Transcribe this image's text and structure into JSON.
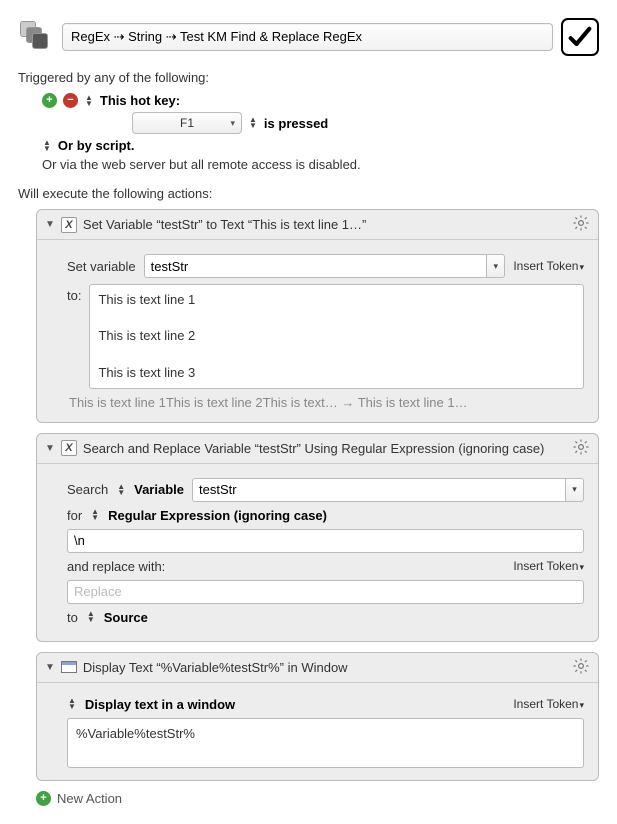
{
  "titlebar": {
    "macro_path": "RegEx ⇢ String ⇢ Test KM Find & Replace RegEx"
  },
  "triggers": {
    "intro": "Triggered by any of the following:",
    "hotkey_label": "This hot key:",
    "hotkey_value": "F1",
    "pressed_label": "is pressed",
    "script_label": "Or by script.",
    "webserver_note": "Or via the web server but all remote access is disabled."
  },
  "actions_intro": "Will execute the following actions:",
  "tokens": {
    "insert_token": "Insert Token"
  },
  "action1": {
    "title": "Set Variable “testStr” to Text “This is text line 1…”",
    "set_variable_label": "Set variable",
    "var_name": "testStr",
    "to_label": "to:",
    "body_l1": "This is text line 1",
    "body_l2": "This is text line 2",
    "body_l3": "This is text line 3",
    "preview": "This is text line 1This is text line 2This is text… → This is text line 1…"
  },
  "action2": {
    "title": "Search and Replace Variable “testStr” Using Regular Expression (ignoring case)",
    "search_label": "Search",
    "variable_label": "Variable",
    "var_name": "testStr",
    "for_label": "for",
    "regex_label": "Regular Expression (ignoring case)",
    "regex_value": "\\n",
    "replace_label": "and replace with:",
    "replace_placeholder": "Replace",
    "to_label": "to",
    "source_label": "Source"
  },
  "action3": {
    "title": "Display Text “%Variable%testStr%” in Window",
    "display_label": "Display text in a window",
    "body": "%Variable%testStr%"
  },
  "footer": {
    "new_action": "New Action"
  }
}
